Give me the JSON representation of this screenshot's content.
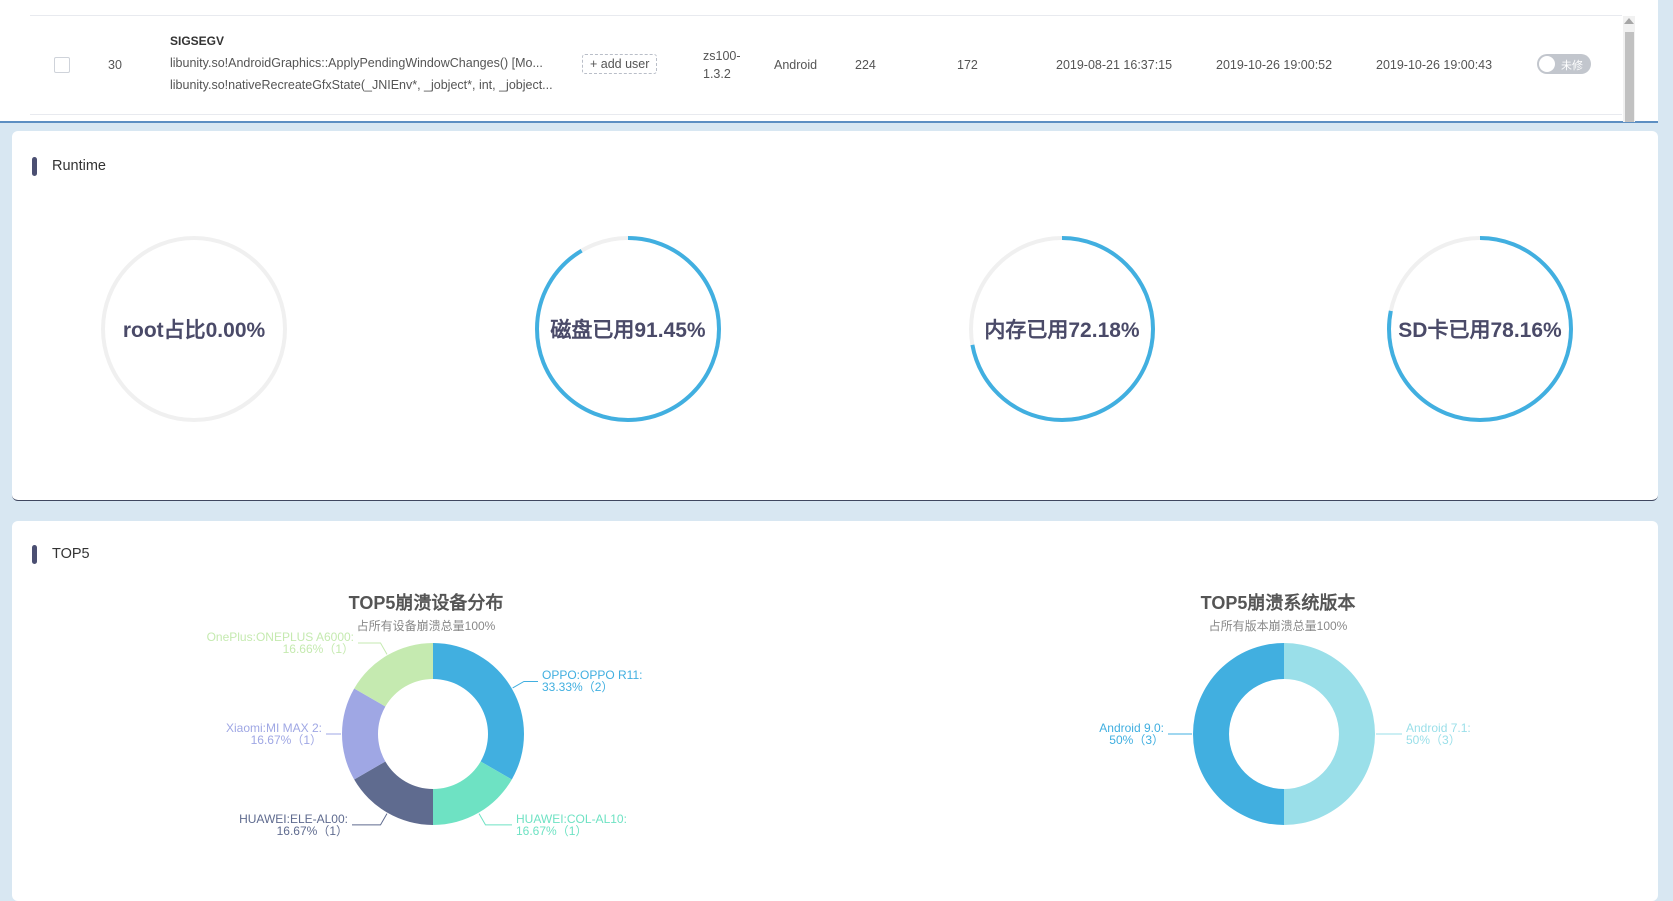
{
  "table": {
    "row": {
      "index": "30",
      "signal": "SIGSEGV",
      "stack_line_1": "libunity.so!AndroidGraphics::ApplyPendingWindowChanges() [Mo...",
      "stack_line_2": "libunity.so!nativeRecreateGfxState(_JNIEnv*, _jobject*, int, _jobject...",
      "add_user_label": "+ add user",
      "version_line_1": "zs100-",
      "version_line_2": "1.3.2",
      "platform": "Android",
      "count_1": "224",
      "count_2": "172",
      "first_time": "2019-08-21 16:37:15",
      "last_time_1": "2019-10-26 19:00:52",
      "last_time_2": "2019-10-26 19:00:43",
      "toggle_label": "未修"
    }
  },
  "runtime": {
    "title": "Runtime",
    "gauges": [
      {
        "label": "root占比0.00%",
        "value": 0.0
      },
      {
        "label": "磁盘已用91.45%",
        "value": 91.45
      },
      {
        "label": "内存已用72.18%",
        "value": 72.18
      },
      {
        "label": "SD卡已用78.16%",
        "value": 78.16
      }
    ],
    "colors": {
      "track": "#f0f0f0",
      "fill": "#41afe0"
    }
  },
  "top5": {
    "title": "TOP5"
  },
  "chart_data": [
    {
      "type": "pie",
      "title": "TOP5崩溃设备分布",
      "subtitle": "占所有设备崩溃总量100%",
      "slices": [
        {
          "name": "OPPO:OPPO R11",
          "percent": "33.33%",
          "count": 2,
          "value": 33.33,
          "color": "#41afe0"
        },
        {
          "name": "HUAWEI:COL-AL10",
          "percent": "16.67%",
          "count": 1,
          "value": 16.67,
          "color": "#6ee2c3"
        },
        {
          "name": "HUAWEI:ELE-AL00",
          "percent": "16.67%",
          "count": 1,
          "value": 16.67,
          "color": "#5f6b8f"
        },
        {
          "name": "Xiaomi:MI MAX 2",
          "percent": "16.67%",
          "count": 1,
          "value": 16.67,
          "color": "#9fa7e4"
        },
        {
          "name": "OnePlus:ONEPLUS A6000",
          "percent": "16.66%",
          "count": 1,
          "value": 16.66,
          "color": "#c5eab0"
        }
      ]
    },
    {
      "type": "pie",
      "title": "TOP5崩溃系统版本",
      "subtitle": "占所有版本崩溃总量100%",
      "slices": [
        {
          "name": "Android 7.1",
          "percent": "50%",
          "count": 3,
          "value": 50,
          "color": "#9adfe9"
        },
        {
          "name": "Android 9.0",
          "percent": "50%",
          "count": 3,
          "value": 50,
          "color": "#41afe0"
        }
      ]
    }
  ]
}
